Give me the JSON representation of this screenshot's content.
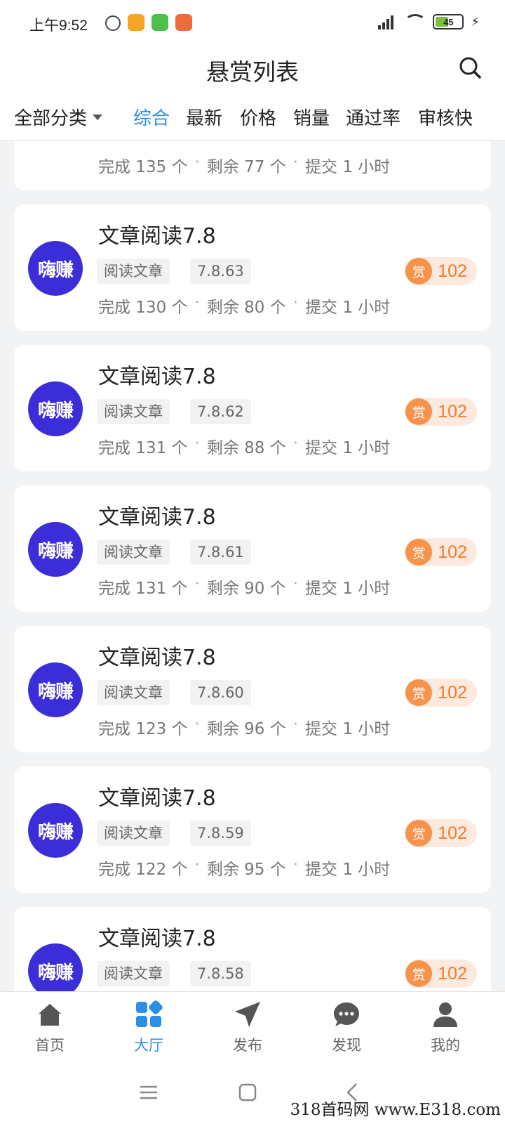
{
  "status_bar": {
    "time": "上午9:52",
    "battery": "45"
  },
  "header": {
    "title": "悬赏列表"
  },
  "filter_bar": {
    "all_label": "全部分类",
    "tabs": [
      {
        "label": "综合",
        "active": true
      },
      {
        "label": "最新",
        "active": false
      },
      {
        "label": "价格",
        "active": false
      },
      {
        "label": "销量",
        "active": false
      },
      {
        "label": "通过率",
        "active": false
      },
      {
        "label": "审核快",
        "active": false
      }
    ]
  },
  "colors": {
    "accent": "#2c8fe3",
    "logo_bg": "#3b2ed8",
    "reward": "#f07a2e",
    "reward_bg": "#fde9dd"
  },
  "list": {
    "partial_top": {
      "completed": "完成 135 个",
      "remaining": "剩余 77 个",
      "submit": "提交 1 小时"
    },
    "cards": [
      {
        "logo": "嗨赚",
        "title": "文章阅读7.8",
        "tag1": "阅读文章",
        "tag2": "7.8.63",
        "reward_icon": "赏",
        "reward": "102",
        "completed": "完成 130 个",
        "remaining": "剩余 80 个",
        "submit": "提交 1 小时"
      },
      {
        "logo": "嗨赚",
        "title": "文章阅读7.8",
        "tag1": "阅读文章",
        "tag2": "7.8.62",
        "reward_icon": "赏",
        "reward": "102",
        "completed": "完成 131 个",
        "remaining": "剩余 88 个",
        "submit": "提交 1 小时"
      },
      {
        "logo": "嗨赚",
        "title": "文章阅读7.8",
        "tag1": "阅读文章",
        "tag2": "7.8.61",
        "reward_icon": "赏",
        "reward": "102",
        "completed": "完成 131 个",
        "remaining": "剩余 90 个",
        "submit": "提交 1 小时"
      },
      {
        "logo": "嗨赚",
        "title": "文章阅读7.8",
        "tag1": "阅读文章",
        "tag2": "7.8.60",
        "reward_icon": "赏",
        "reward": "102",
        "completed": "完成 123 个",
        "remaining": "剩余 96 个",
        "submit": "提交 1 小时"
      },
      {
        "logo": "嗨赚",
        "title": "文章阅读7.8",
        "tag1": "阅读文章",
        "tag2": "7.8.59",
        "reward_icon": "赏",
        "reward": "102",
        "completed": "完成 122 个",
        "remaining": "剩余 95 个",
        "submit": "提交 1 小时"
      }
    ],
    "partial_bottom": {
      "logo": "嗨赚",
      "title": "文章阅读7.8",
      "tag1": "阅读文章",
      "tag2": "7.8.58",
      "reward_icon": "赏",
      "reward": "102"
    }
  },
  "bottom_nav": [
    {
      "label": "首页",
      "icon": "home-icon",
      "active": false
    },
    {
      "label": "大厅",
      "icon": "grid-icon",
      "active": true
    },
    {
      "label": "发布",
      "icon": "send-icon",
      "active": false
    },
    {
      "label": "发现",
      "icon": "chat-icon",
      "active": false
    },
    {
      "label": "我的",
      "icon": "user-icon",
      "active": false
    }
  ],
  "watermark": "318首码网 www.E318.com"
}
